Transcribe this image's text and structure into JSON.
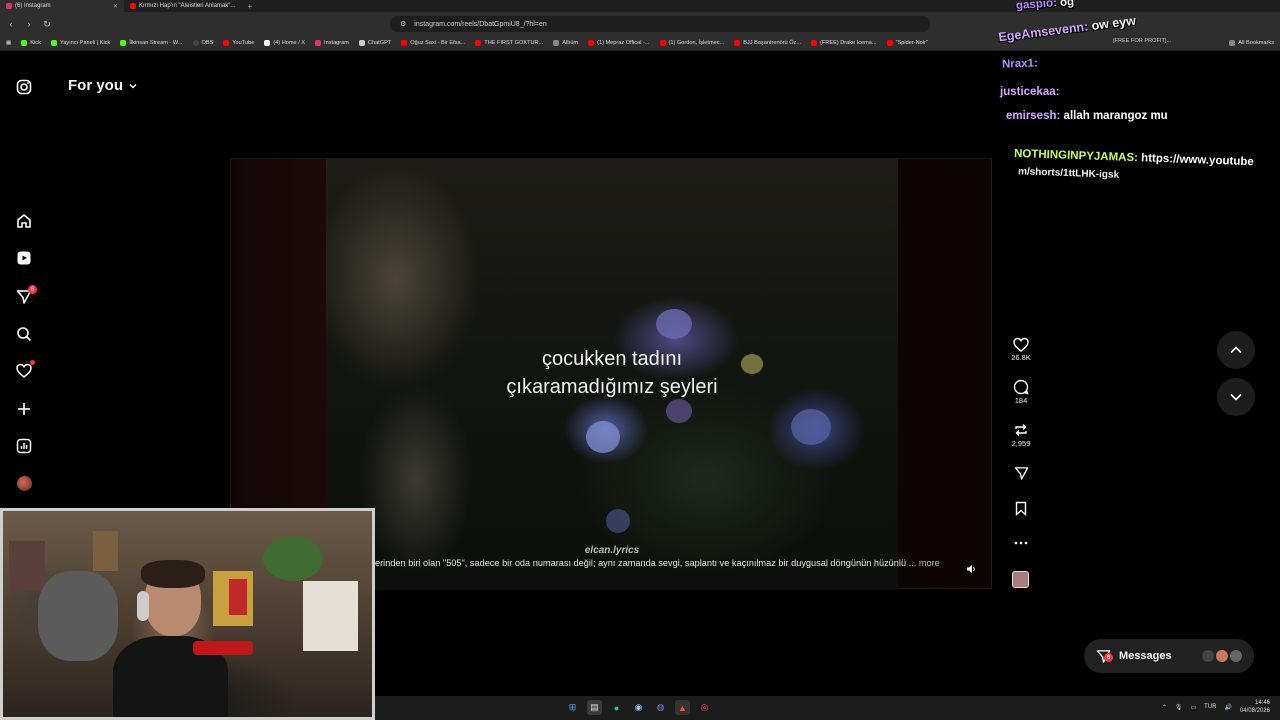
{
  "browser": {
    "tabs": [
      {
        "label": "(6) Instagram",
        "active": true
      },
      {
        "label": "Kırmızı Hap'ın \"Ateistleri Anlamak\"..."
      }
    ],
    "url": "instagram.com/reels/DbatGpmiU8_/?hl=en",
    "bookmarks": [
      "Kick",
      "Yayıncı Paneli | Kick",
      "İlkinsan Stream - W...",
      "OBS",
      "YouTube",
      "(4) Home / X",
      "Instagram",
      "ChatGPT",
      "Oğuz Saxi - Bir Efsa...",
      "THE FIRST GOKTUR...",
      "Albüm",
      "(1) Mepraz Offical -...",
      "(1) Gordon, İşletmec...",
      "BJJ Başantrenörü Öz...",
      "(FREE) Drake Icema...",
      "\"Spider-Noir\"",
      "All Bookmarks"
    ]
  },
  "instagram": {
    "feed_title": "For you",
    "sidebar_badge": "6",
    "reel": {
      "caption_line1": "çocukken tadını",
      "caption_line2": "çıkaramadığımız şeyleri",
      "watermark": "elcan.lyrics",
      "description": "erinden biri olan \"505\", sadece bir oda numarası değil; aynı zamanda sevgi, saplantı ve kaçınılmaz bir duygusal döngünün hüzünlü ...",
      "more_label": "more"
    },
    "actions": {
      "likes": "26.8K",
      "comments": "184",
      "reposts": "2,959"
    },
    "messages_label": "Messages",
    "messages_badge": "6"
  },
  "chat": [
    {
      "user": "gaspio:",
      "message": "og"
    },
    {
      "user": "EgeAmsevenn:",
      "message": "ow eyw"
    },
    {
      "user": "Nrax1:",
      "message": ""
    },
    {
      "user": "justicekaa:",
      "message": ""
    },
    {
      "user": "emirsesh:",
      "message": "allah marangoz mu"
    },
    {
      "user": "NOTHINGINPYJAMAS:",
      "message": "https://www.youtube",
      "message_cont": "m/shorts/1ttLHK-igsk"
    }
  ],
  "chat_fragment": "[FREE FOR PROFIT]...",
  "taskbar": {
    "lang": "TUR",
    "time": "14:46",
    "date": "04/08/2026"
  }
}
